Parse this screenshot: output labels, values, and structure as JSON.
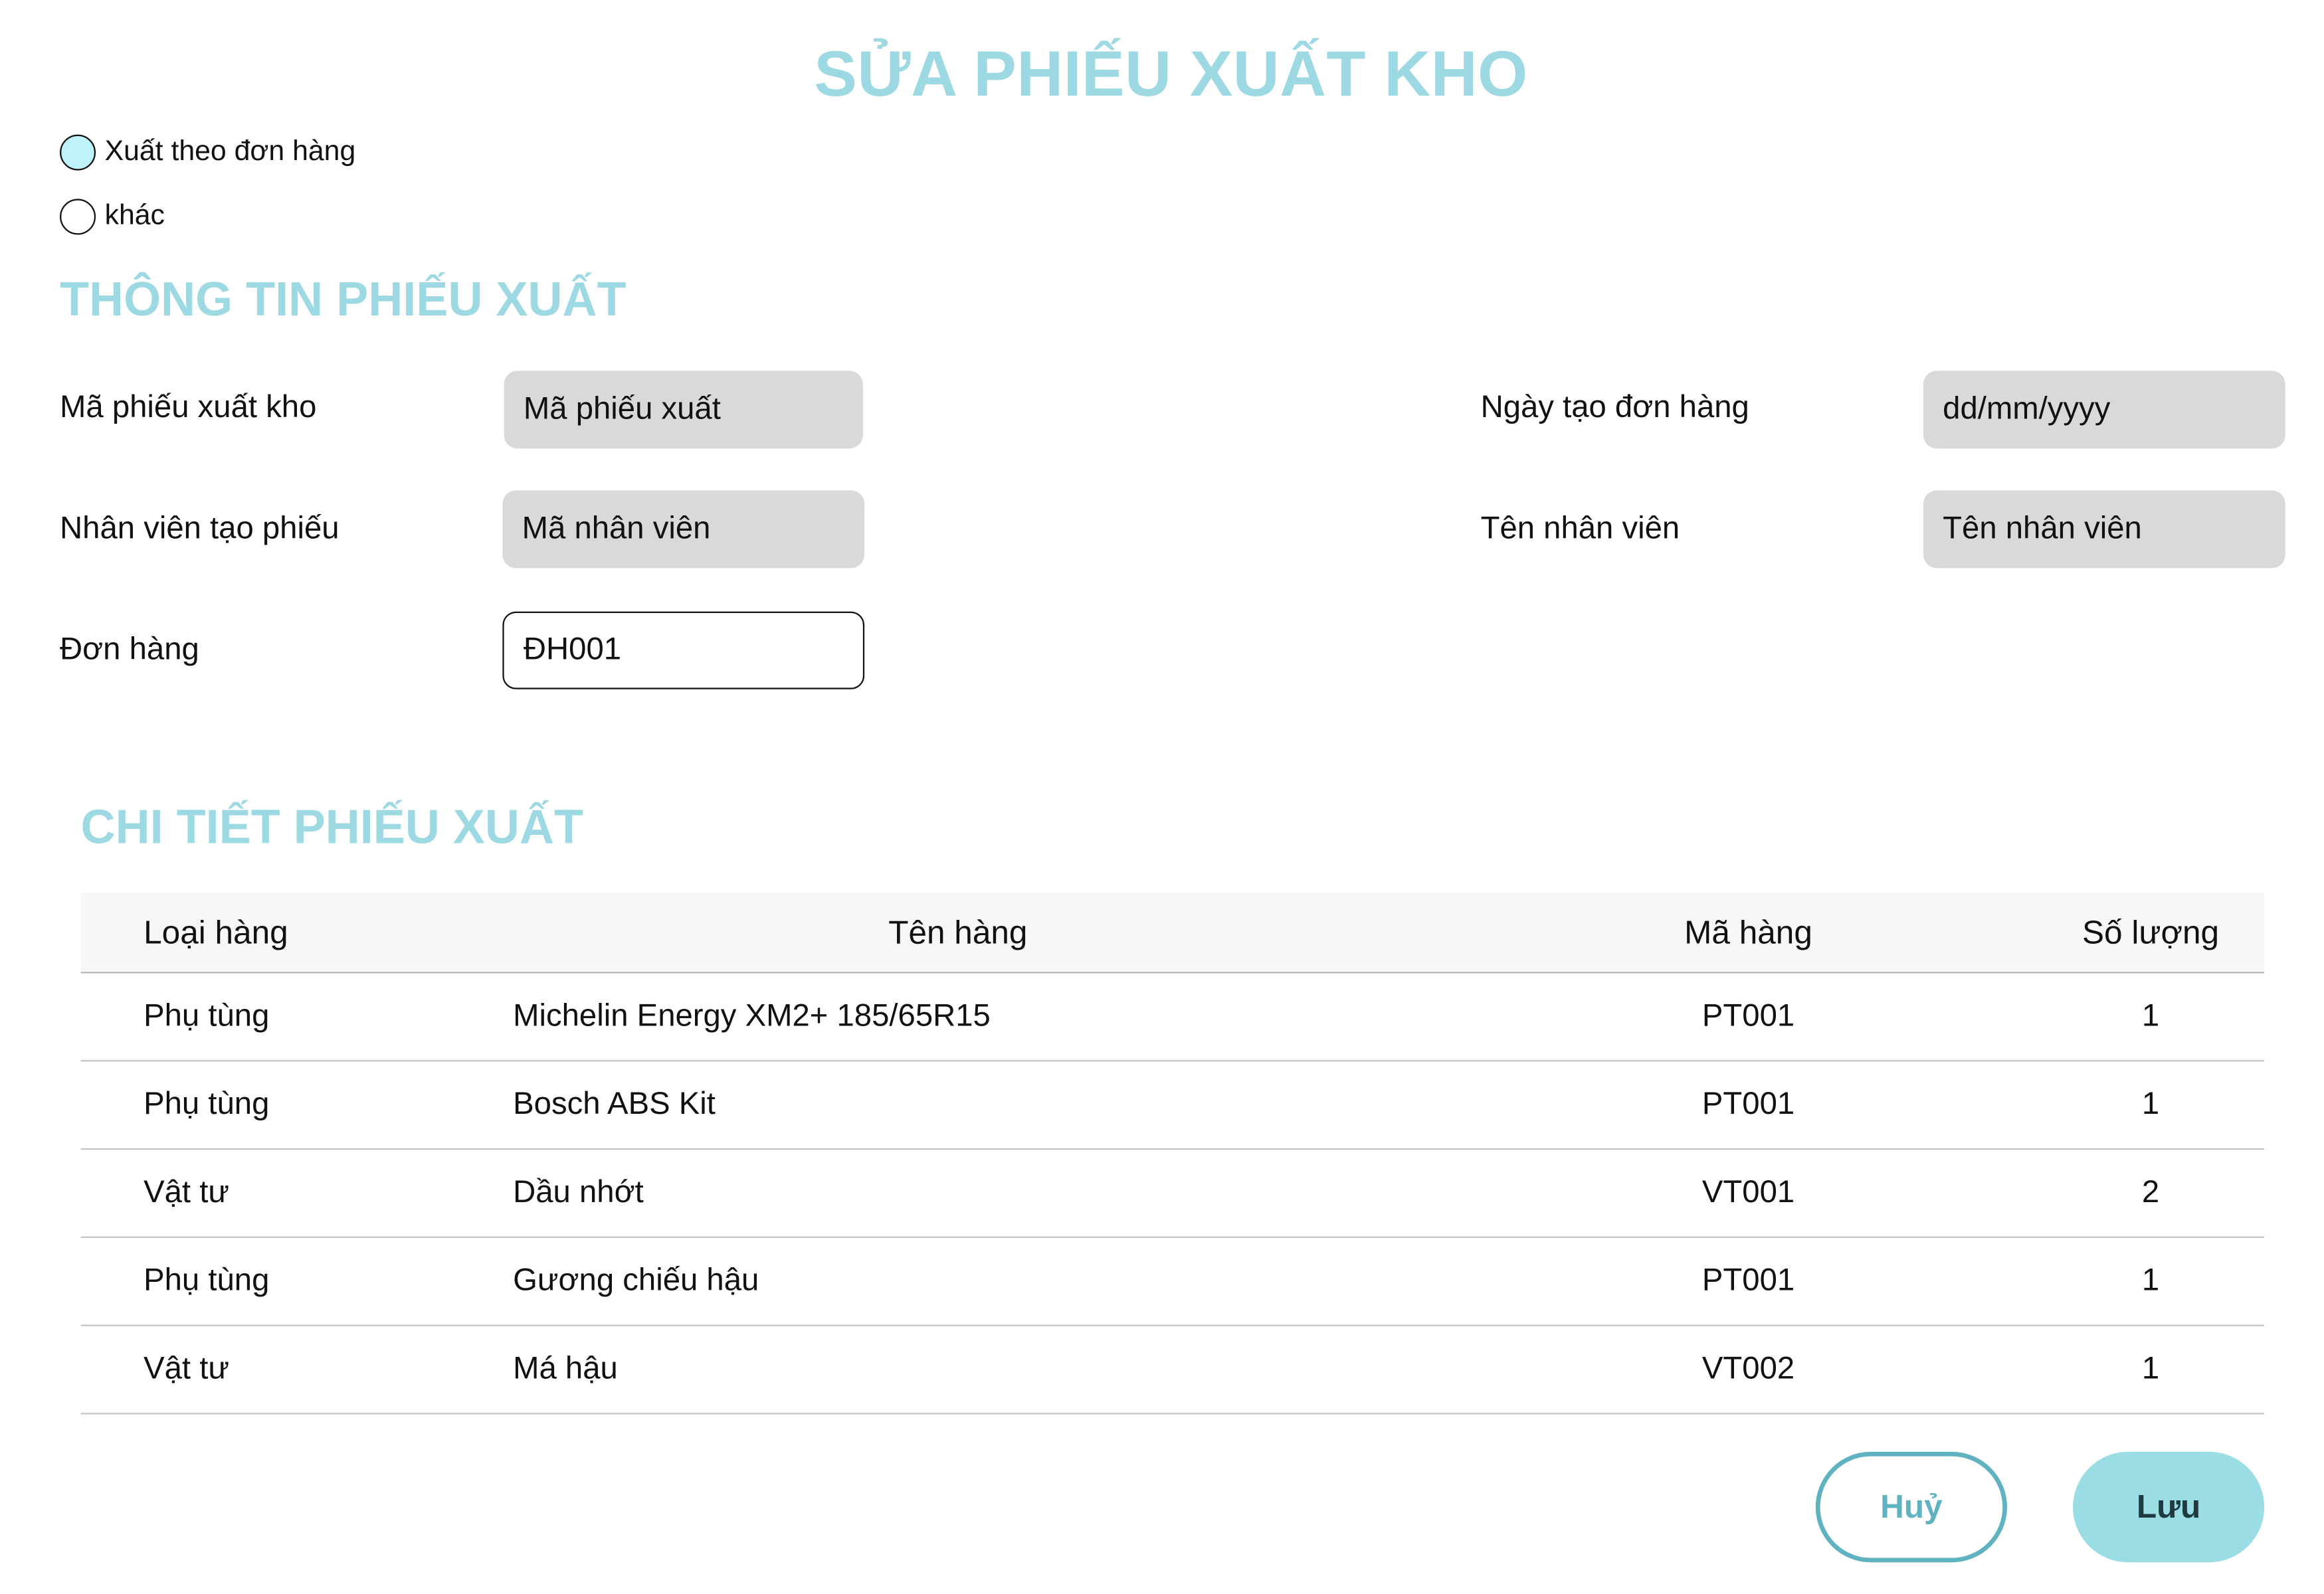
{
  "page_title": "SỬA PHIẾU XUẤT KHO",
  "export_type": {
    "options": [
      {
        "label": "Xuất theo đơn hàng",
        "selected": true
      },
      {
        "label": "khác",
        "selected": false
      }
    ]
  },
  "info_section": {
    "title": "THÔNG TIN PHIẾU XUẤT",
    "fields": {
      "receipt_code": {
        "label": "Mã phiếu xuất kho",
        "placeholder": "Mã phiếu xuất"
      },
      "order_date": {
        "label": "Ngày tạo đơn hàng",
        "placeholder": "dd/mm/yyyy"
      },
      "employee_code": {
        "label": "Nhân viên tạo phiếu",
        "placeholder": "Mã nhân viên"
      },
      "employee_name": {
        "label": "Tên nhân viên",
        "placeholder": "Tên nhân viên"
      },
      "order": {
        "label": "Đơn hàng",
        "value": "ĐH001"
      }
    }
  },
  "detail_section": {
    "title": "CHI TIẾT PHIẾU XUẤT",
    "columns": [
      "Loại hàng",
      "Tên hàng",
      "Mã hàng",
      "Số lượng"
    ],
    "rows": [
      [
        "Phụ tùng",
        "Michelin Energy XM2+ 185/65R15",
        "PT001",
        "1"
      ],
      [
        "Phụ tùng",
        "Bosch ABS Kit",
        "PT001",
        "1"
      ],
      [
        "Vật tư",
        "Dầu nhớt",
        "VT001",
        "2"
      ],
      [
        "Phụ tùng",
        "Gương chiếu hậu",
        "PT001",
        "1"
      ],
      [
        "Vật tư",
        "Má hậu",
        "VT002",
        "1"
      ]
    ]
  },
  "actions": {
    "cancel_label": "Huỷ",
    "save_label": "Lưu"
  },
  "colors": {
    "accent": "#9dd9e2",
    "field_bg": "#d9d9d9",
    "cancel_border": "#5fb2bf",
    "save_bg": "#9bdde5"
  }
}
